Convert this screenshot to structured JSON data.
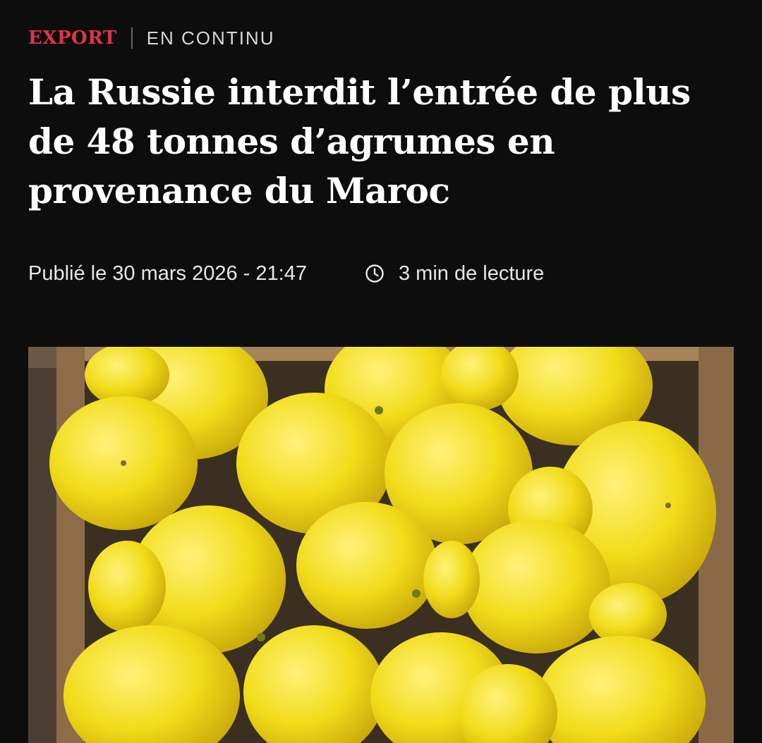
{
  "kicker": {
    "category": "EXPORT",
    "section": "EN CONTINU",
    "category_color": "#e0334d"
  },
  "article": {
    "title": "La Russie interdit l’entrée de plus de 48 tonnes d’agrumes en provenance du Maroc",
    "published": "Publié le 30 mars 2026 - 21:47",
    "read_time": "3 min de lecture"
  },
  "hero_image": {
    "subject": "lemons-in-cardboard-box"
  },
  "icons": {
    "read_time": "clock-icon"
  }
}
